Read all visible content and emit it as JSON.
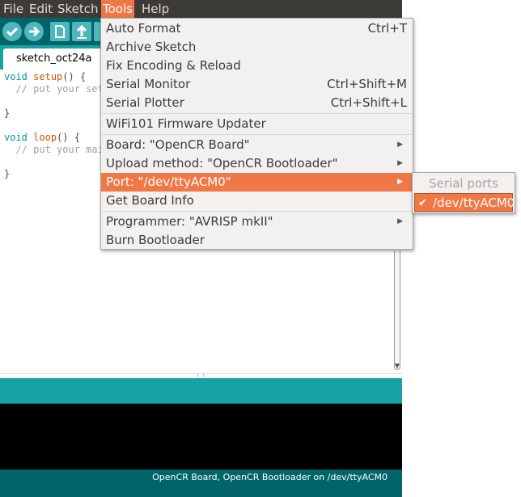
{
  "menubar": {
    "file": "File",
    "edit": "Edit",
    "sketch": "Sketch",
    "tools": "Tools",
    "help": "Help"
  },
  "toolbar": {
    "verify_icon": "checkmark-icon",
    "upload_icon": "arrow-right-icon",
    "new_icon": "new-file-icon",
    "open_icon": "arrow-up-icon",
    "save_icon": "arrow-down-icon"
  },
  "tab": {
    "label": "sketch_oct24a"
  },
  "editor": {
    "lines": [
      "void setup() {",
      "  // put your set",
      "",
      "}",
      "",
      "void loop() {",
      "  // put your mai",
      "",
      "}"
    ]
  },
  "tools_menu": {
    "items": [
      {
        "label": "Auto Format",
        "shortcut": "Ctrl+T"
      },
      {
        "label": "Archive Sketch",
        "shortcut": ""
      },
      {
        "label": "Fix Encoding & Reload",
        "shortcut": ""
      },
      {
        "label": "Serial Monitor",
        "shortcut": "Ctrl+Shift+M"
      },
      {
        "label": "Serial Plotter",
        "shortcut": "Ctrl+Shift+L"
      },
      {
        "label": "WiFi101 Firmware Updater",
        "shortcut": ""
      },
      {
        "label": "Board: \"OpenCR Board\"",
        "shortcut": ""
      },
      {
        "label": "Upload method: \"OpenCR Bootloader\"",
        "shortcut": ""
      },
      {
        "label": "Port: \"/dev/ttyACM0\"",
        "shortcut": ""
      },
      {
        "label": "Get Board Info",
        "shortcut": ""
      },
      {
        "label": "Programmer: \"AVRISP mkII\"",
        "shortcut": ""
      },
      {
        "label": "Burn Bootloader",
        "shortcut": ""
      }
    ]
  },
  "port_submenu": {
    "header": "Serial ports",
    "item": "/dev/ttyACM0"
  },
  "footer": {
    "status": "OpenCR Board, OpenCR Bootloader on /dev/ttyACM0"
  },
  "colors": {
    "accent": "#f07746",
    "toolbar_dark": "#006468",
    "toolbar_light": "#17a1a5",
    "menubar": "#3c3b37"
  }
}
